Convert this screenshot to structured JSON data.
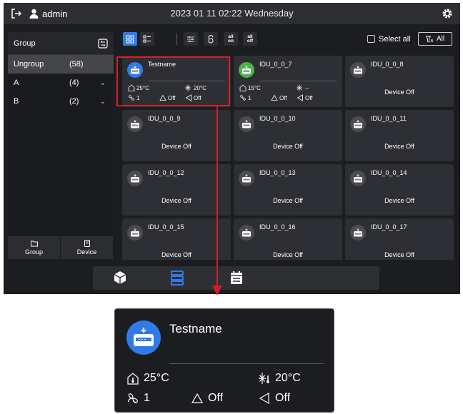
{
  "header": {
    "username": "admin",
    "datetime": "2023 01 11 02:22 Wednesday",
    "icons": [
      "logout-icon",
      "user-icon",
      "gear-icon"
    ]
  },
  "sidebar": {
    "title": "Group",
    "items": [
      {
        "name": "Ungroup",
        "count": "(58)",
        "expandable": false,
        "active": true
      },
      {
        "name": "A",
        "count": "(4)",
        "expandable": true,
        "active": false
      },
      {
        "name": "B",
        "count": "(2)",
        "expandable": true,
        "active": false
      }
    ],
    "bottom_buttons": [
      {
        "label": "Group",
        "icon": "folder-icon"
      },
      {
        "label": "Device",
        "icon": "device-icon"
      }
    ]
  },
  "toolbar": {
    "all_on": {
      "line1": "all",
      "line2": "on"
    },
    "all_off": {
      "line1": "all",
      "line2": "off"
    },
    "select_all_label": "Select all",
    "filter_label": "All"
  },
  "devices": [
    {
      "name": "Testname",
      "icon_color": "blue",
      "status": "on",
      "indoor_temp": "25°C",
      "set_temp": "20°C",
      "fan": "1",
      "swing1": "Off",
      "swing2": "Off"
    },
    {
      "name": "IDU_0_0_7",
      "icon_color": "green",
      "status": "on",
      "indoor_temp": "15°C",
      "set_temp": "--",
      "fan": "1",
      "swing1": "Off",
      "swing2": "Off"
    },
    {
      "name": "IDU_0_0_8",
      "icon_color": "gray",
      "status": "Device Off"
    },
    {
      "name": "IDU_0_0_9",
      "icon_color": "gray",
      "status": "Device Off"
    },
    {
      "name": "IDU_0_0_10",
      "icon_color": "gray",
      "status": "Device Off"
    },
    {
      "name": "IDU_0_0_11",
      "icon_color": "gray",
      "status": "Device Off"
    },
    {
      "name": "IDU_0_0_12",
      "icon_color": "gray",
      "status": "Device Off"
    },
    {
      "name": "IDU_0_0_13",
      "icon_color": "gray",
      "status": "Device Off"
    },
    {
      "name": "IDU_0_0_14",
      "icon_color": "gray",
      "status": "Device Off"
    },
    {
      "name": "IDU_0_0_15",
      "icon_color": "gray",
      "status": "Device Off"
    },
    {
      "name": "IDU_0_0_16",
      "icon_color": "gray",
      "status": "Device Off"
    },
    {
      "name": "IDU_0_0_17",
      "icon_color": "gray",
      "status": "Device Off"
    }
  ],
  "bottom_nav": [
    "cube-icon",
    "list-icon",
    "calendar-icon"
  ],
  "zoom": {
    "name": "Testname",
    "indoor_temp": "25°C",
    "set_temp": "20°C",
    "fan": "1",
    "swing1": "Off",
    "swing2": "Off"
  },
  "colors": {
    "accent_blue": "#2f7be9",
    "online_green": "#4cb448",
    "highlight_red": "#d21f26",
    "background": "#1c1d21",
    "card": "#2e2f34"
  }
}
